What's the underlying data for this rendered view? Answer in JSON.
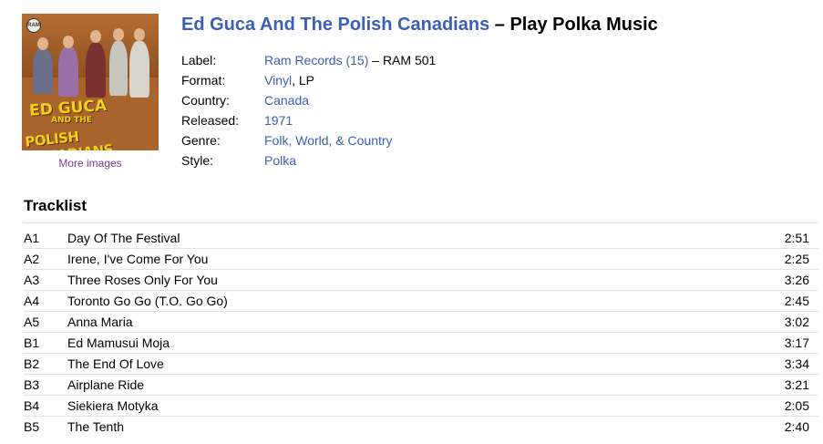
{
  "release": {
    "artist": "Ed Guca And The Polish Canadians",
    "separator": " – ",
    "title": "Play Polka Music",
    "more_images": "More images",
    "cover": {
      "line1": "ED GUCA",
      "line2": "AND THE",
      "line3": "POLISH CANADIANS",
      "label_logo": "RAM"
    }
  },
  "details": {
    "label": {
      "key": "Label:",
      "link": "Ram Records (15)",
      "rest": " – RAM 501"
    },
    "format": {
      "key": "Format:",
      "link": "Vinyl",
      "rest": ", LP"
    },
    "country": {
      "key": "Country:",
      "link": "Canada"
    },
    "released": {
      "key": "Released:",
      "link": "1971"
    },
    "genre": {
      "key": "Genre:",
      "link": "Folk, World, & Country"
    },
    "style": {
      "key": "Style:",
      "link": "Polka"
    }
  },
  "tracklist": {
    "heading": "Tracklist",
    "tracks": [
      {
        "pos": "A1",
        "title": "Day Of The Festival",
        "dur": "2:51"
      },
      {
        "pos": "A2",
        "title": "Irene, I've Come For You",
        "dur": "2:25"
      },
      {
        "pos": "A3",
        "title": "Three Roses Only For You",
        "dur": "3:26"
      },
      {
        "pos": "A4",
        "title": "Toronto Go Go (T.O. Go Go)",
        "dur": "2:45"
      },
      {
        "pos": "A5",
        "title": "Anna Maria",
        "dur": "3:02"
      },
      {
        "pos": "B1",
        "title": "Ed Mamusui Moja",
        "dur": "3:17"
      },
      {
        "pos": "B2",
        "title": "The End Of Love",
        "dur": "3:34"
      },
      {
        "pos": "B3",
        "title": "Airplane Ride",
        "dur": "3:21"
      },
      {
        "pos": "B4",
        "title": "Siekiera Motyka",
        "dur": "2:05"
      },
      {
        "pos": "B5",
        "title": "The Tenth",
        "dur": "2:40"
      }
    ]
  },
  "colors": {
    "link": "#3a5fb5",
    "visited": "#7e3b8c",
    "rule": "#e4e4e4"
  }
}
